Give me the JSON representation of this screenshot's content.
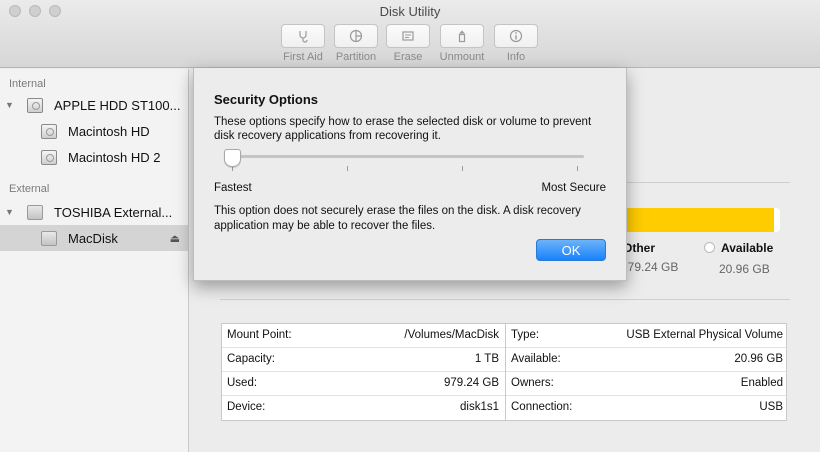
{
  "window": {
    "title": "Disk Utility"
  },
  "toolbar": {
    "items": [
      {
        "label": "First Aid",
        "icon": "stethoscope-icon"
      },
      {
        "label": "Partition",
        "icon": "pie-icon"
      },
      {
        "label": "Erase",
        "icon": "eraser-icon"
      },
      {
        "label": "Unmount",
        "icon": "unmount-icon"
      },
      {
        "label": "Info",
        "icon": "info-icon"
      }
    ]
  },
  "sidebar": {
    "internal_header": "Internal",
    "external_header": "External",
    "items": [
      {
        "label": "APPLE HDD ST100..."
      },
      {
        "label": "Macintosh HD"
      },
      {
        "label": "Macintosh HD 2"
      },
      {
        "label": "TOSHIBA External..."
      },
      {
        "label": "MacDisk",
        "eject": "⏏"
      }
    ]
  },
  "usage": {
    "other_label": "Other",
    "other_value": "979.24 GB",
    "available_label": "Available",
    "available_value": "20.96 GB",
    "other_color": "#ffcc00"
  },
  "info": {
    "left": [
      {
        "key": "Mount Point:",
        "value": "/Volumes/MacDisk"
      },
      {
        "key": "Capacity:",
        "value": "1 TB"
      },
      {
        "key": "Used:",
        "value": "979.24 GB"
      },
      {
        "key": "Device:",
        "value": "disk1s1"
      }
    ],
    "right": [
      {
        "key": "Type:",
        "value": "USB External Physical Volume"
      },
      {
        "key": "Available:",
        "value": "20.96 GB"
      },
      {
        "key": "Owners:",
        "value": "Enabled"
      },
      {
        "key": "Connection:",
        "value": "USB"
      }
    ]
  },
  "sheet": {
    "title": "Security Options",
    "description": "These options specify how to erase the selected disk or volume to prevent disk recovery applications from recovering it.",
    "slider_min": "Fastest",
    "slider_max": "Most Secure",
    "slider_level": 0,
    "note": "This option does not securely erase the files on the disk. A disk recovery application may be able to recover the files.",
    "ok_label": "OK",
    "accent": "#1a82fb"
  }
}
